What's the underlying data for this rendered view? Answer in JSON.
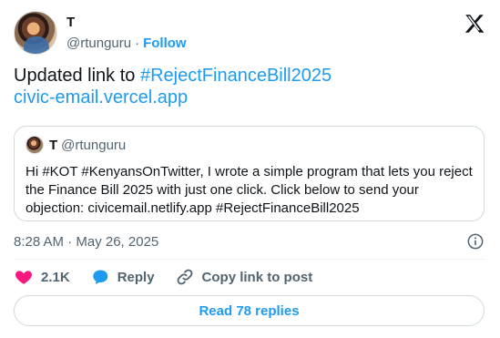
{
  "author": {
    "display_name": "T",
    "handle": "@rtunguru",
    "separator": "·",
    "follow_label": "Follow",
    "avatar_icon": "profile-photo"
  },
  "brand": {
    "logo_icon": "x-logo-icon"
  },
  "tweet": {
    "line1_prefix": "Updated link to ",
    "hashtag": "#RejectFinanceBill2025",
    "url": "civic-email.vercel.app"
  },
  "quote": {
    "display_name": "T",
    "handle": "@rtunguru",
    "body": "Hi #KOT #KenyansOnTwitter, I wrote a simple program that lets you reject the Finance Bill 2025 with just one click. Click below to send your objection: civicemail.netlify.app #RejectFinanceBill2025"
  },
  "meta": {
    "timestamp": "8:28 AM · May 26, 2025",
    "info_icon": "info-icon"
  },
  "actions": {
    "likes": "2.1K",
    "reply_label": "Reply",
    "copy_link_label": "Copy link to post",
    "like_icon": "heart-icon",
    "reply_icon": "reply-bubble-icon",
    "copy_icon": "link-icon"
  },
  "footer": {
    "read_replies_label": "Read 78 replies"
  },
  "colors": {
    "accent": "#1d9bf0",
    "like": "#f91880",
    "text": "#0f1419",
    "muted": "#536471",
    "border": "#cfd9de"
  }
}
